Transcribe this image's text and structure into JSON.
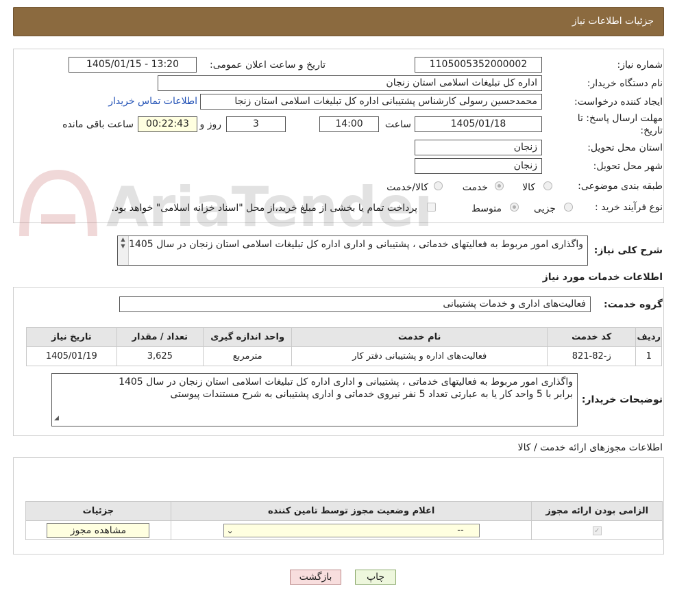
{
  "header": {
    "title": "جزئیات اطلاعات نیاز"
  },
  "watermark": {
    "text": "AriaTender.neT"
  },
  "form": {
    "need_number": {
      "label": "شماره نیاز:",
      "value": "1105005352000002"
    },
    "announce_datetime": {
      "label": "تاریخ و ساعت اعلان عمومی:",
      "value": "1405/01/15 - 13:20"
    },
    "buyer_org": {
      "label": "نام دستگاه خریدار:",
      "value": "اداره کل تبلیغات اسلامی استان زنجان"
    },
    "requester": {
      "label": "ایجاد کننده درخواست:",
      "value": "محمدحسین رسولی کارشناس پشتیبانی  اداره کل تبلیغات اسلامی استان زنجا",
      "contact_link": "اطلاعات تماس خریدار"
    },
    "deadline": {
      "label_line1": "مهلت ارسال پاسخ: تا",
      "label_line2": "تاریخ:",
      "date": "1405/01/18",
      "time_label": "ساعت",
      "time": "14:00",
      "days": "3",
      "days_label": "روز و",
      "remaining": "00:22:43",
      "remaining_label": "ساعت باقی مانده"
    },
    "delivery_province": {
      "label": "استان محل تحویل:",
      "value": "زنجان"
    },
    "delivery_city": {
      "label": "شهر محل تحویل:",
      "value": "زنجان"
    },
    "category": {
      "label": "طبقه بندی موضوعی:",
      "options": [
        "کالا",
        "خدمت",
        "کالا/خدمت"
      ],
      "selected": "خدمت"
    },
    "purchase_type": {
      "label": "نوع فرآیند خرید :",
      "options": [
        "جزیی",
        "متوسط"
      ],
      "selected": "متوسط",
      "payment_note": "پرداخت تمام یا بخشی از مبلغ خرید،از محل \"اسناد خزانه اسلامی\" خواهد بود."
    }
  },
  "general_description": {
    "label": "شرح کلی نیاز:",
    "value": "واگذاری امور مربوط به فعالیتهای خدماتی ، پشتیبانی و اداری اداره کل تبلیغات اسلامی استان زنجان در سال 1405"
  },
  "services_info": {
    "title": "اطلاعات خدمات مورد نیاز",
    "group_label": "گروه خدمت:",
    "group_value": "فعالیت‌های اداری و خدمات پشتیبانی",
    "columns": [
      "ردیف",
      "کد خدمت",
      "نام خدمت",
      "واحد اندازه گیری",
      "تعداد / مقدار",
      "تاریخ نیاز"
    ],
    "rows": [
      [
        "1",
        "ز-82-821",
        "فعالیت‌های اداره و پشتیبانی دفتر کار",
        "مترمربع",
        "3,625",
        "1405/01/19"
      ]
    ]
  },
  "buyer_notes": {
    "label": "توضیحات خریدار:",
    "line1": "واگذاری امور مربوط به فعالیتهای خدماتی ، پشتیبانی و اداری اداره کل تبلیغات اسلامی استان زنجان در سال 1405",
    "line2": "برابر با 5 واحد کار یا به عبارتی  تعداد 5 نفر نیروی خدماتی و اداری پشتیبانی به شرح مستندات پیوستی"
  },
  "permits": {
    "title": "اطلاعات مجوزهای ارائه خدمت / کالا",
    "columns": [
      "الزامی بودن ارائه مجوز",
      "اعلام وضعیت مجوز توسط تامین کننده",
      "جزئیات"
    ],
    "select_value": "--",
    "view_button": "مشاهده مجوز"
  },
  "buttons": {
    "print": "چاپ",
    "back": "بازگشت"
  }
}
